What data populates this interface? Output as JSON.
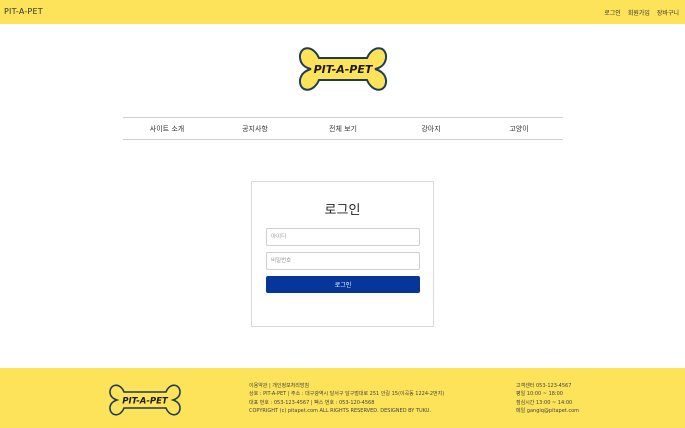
{
  "header": {
    "brand": "PIT-A-PET",
    "links": [
      "로그인",
      "회원가입",
      "장바구니"
    ]
  },
  "logo": {
    "text": "PIT-A-PET"
  },
  "nav": {
    "items": [
      "사이트 소개",
      "공지사항",
      "전체 보기",
      "강아지",
      "고양이"
    ]
  },
  "login": {
    "title": "로그인",
    "id_placeholder": "아이디",
    "pw_placeholder": "비밀번호",
    "button_label": "로그인"
  },
  "footer": {
    "logo_text": "PIT-A-PET",
    "policy_links": "이용약관 | 개인정보처리방침",
    "company_line": "상호 : PIT-A-PET | 주소 : 대구광역시 달서구 달구벌대로 251 안길 15(이곡동 1224-2번지)",
    "contact_line": "대표 번호 : 053-123-4567 | 팩스 번호 : 053-120-4568",
    "copyright": "COPYRIGHT (c) pitapet.com ALL RIGHTS RESERVED. DESIGNED BY TUKU.",
    "cs_center": "고객센터 053-123-4567",
    "weekday_hours": "평일 10:00 ~ 18:00",
    "lunch_hours": "점심시간 13:00 ~ 14:00",
    "email": "메일 gangiq@pitapet.com"
  },
  "colors": {
    "header_bg": "#fde35a",
    "footer_bg": "#fde35a",
    "bone_fill": "#fde35a",
    "bone_outline": "#1f3b57",
    "login_button": "#07369b"
  }
}
